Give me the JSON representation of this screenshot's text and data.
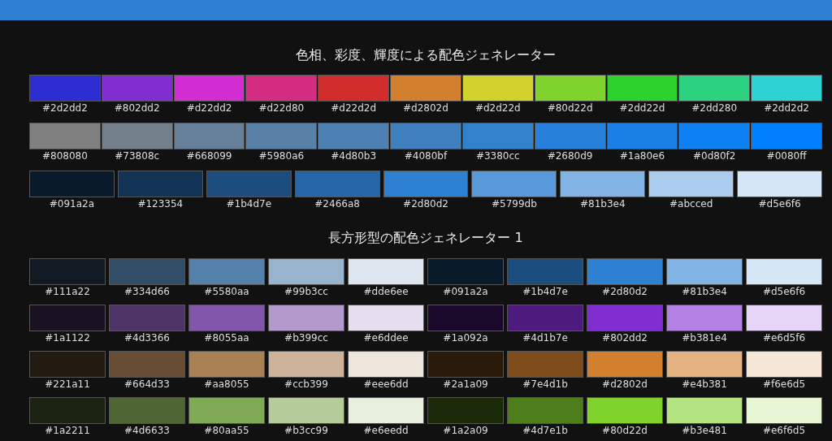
{
  "sections": [
    {
      "title": "色相、彩度、輝度による配色ジェネレーター",
      "grids": [
        [
          [
            {
              "label": "#2d2dd2",
              "color": "#2d2dd2"
            },
            {
              "label": "#802dd2",
              "color": "#802dd2"
            },
            {
              "label": "#d22dd2",
              "color": "#d22dd2"
            },
            {
              "label": "#d22d80",
              "color": "#d22d80"
            },
            {
              "label": "#d22d2d",
              "color": "#d22d2d"
            },
            {
              "label": "#d2802d",
              "color": "#d2802d"
            },
            {
              "label": "#d2d22d",
              "color": "#d2d22d"
            },
            {
              "label": "#80d22d",
              "color": "#80d22d"
            },
            {
              "label": "#2dd22d",
              "color": "#2dd22d"
            },
            {
              "label": "#2dd280",
              "color": "#2dd280"
            },
            {
              "label": "#2dd2d2",
              "color": "#2dd2d2"
            }
          ],
          [
            {
              "label": "#808080",
              "color": "#808080"
            },
            {
              "label": "#73808c",
              "color": "#73808c"
            },
            {
              "label": "#668099",
              "color": "#668099"
            },
            {
              "label": "#5980a6",
              "color": "#5980a6"
            },
            {
              "label": "#4d80b3",
              "color": "#4d80b3"
            },
            {
              "label": "#4080bf",
              "color": "#4080bf"
            },
            {
              "label": "#3380cc",
              "color": "#3380cc"
            },
            {
              "label": "#2680d9",
              "color": "#2680d9"
            },
            {
              "label": "#1a80e6",
              "color": "#1a80e6"
            },
            {
              "label": "#0d80f2",
              "color": "#0d80f2"
            },
            {
              "label": "#0080ff",
              "color": "#0080ff"
            }
          ]
        ],
        [
          [
            {
              "label": "#091a2a",
              "color": "#091a2a"
            },
            {
              "label": "#123354",
              "color": "#123354"
            },
            {
              "label": "#1b4d7e",
              "color": "#1b4d7e"
            },
            {
              "label": "#2466a8",
              "color": "#2466a8"
            },
            {
              "label": "#2d80d2",
              "color": "#2d80d2"
            },
            {
              "label": "#5799db",
              "color": "#5799db"
            },
            {
              "label": "#81b3e4",
              "color": "#81b3e4"
            },
            {
              "label": "#abcced",
              "color": "#abcced"
            },
            {
              "label": "#d5e6f6",
              "color": "#d5e6f6"
            }
          ]
        ]
      ]
    },
    {
      "title": "長方形型の配色ジェネレーター 1",
      "grids": [
        [
          [
            {
              "label": "#111a22",
              "color": "#111a22"
            },
            {
              "label": "#334d66",
              "color": "#334d66"
            },
            {
              "label": "#5580aa",
              "color": "#5580aa"
            },
            {
              "label": "#99b3cc",
              "color": "#99b3cc"
            },
            {
              "label": "#dde6ee",
              "color": "#dde6ee"
            },
            {
              "label": "#091a2a",
              "color": "#091a2a"
            },
            {
              "label": "#1b4d7e",
              "color": "#1b4d7e"
            },
            {
              "label": "#2d80d2",
              "color": "#2d80d2"
            },
            {
              "label": "#81b3e4",
              "color": "#81b3e4"
            },
            {
              "label": "#d5e6f6",
              "color": "#d5e6f6"
            }
          ],
          [
            {
              "label": "#1a1122",
              "color": "#1a1122"
            },
            {
              "label": "#4d3366",
              "color": "#4d3366"
            },
            {
              "label": "#8055aa",
              "color": "#8055aa"
            },
            {
              "label": "#b399cc",
              "color": "#b399cc"
            },
            {
              "label": "#e6ddee",
              "color": "#e6ddee"
            },
            {
              "label": "#1a092a",
              "color": "#1a092a"
            },
            {
              "label": "#4d1b7e",
              "color": "#4d1b7e"
            },
            {
              "label": "#802dd2",
              "color": "#802dd2"
            },
            {
              "label": "#b381e4",
              "color": "#b381e4"
            },
            {
              "label": "#e6d5f6",
              "color": "#e6d5f6"
            }
          ],
          [
            {
              "label": "#221a11",
              "color": "#221a11"
            },
            {
              "label": "#664d33",
              "color": "#664d33"
            },
            {
              "label": "#aa8055",
              "color": "#aa8055"
            },
            {
              "label": "#ccb399",
              "color": "#ccb399"
            },
            {
              "label": "#eee6dd",
              "color": "#eee6dd"
            },
            {
              "label": "#2a1a09",
              "color": "#2a1a09"
            },
            {
              "label": "#7e4d1b",
              "color": "#7e4d1b"
            },
            {
              "label": "#d2802d",
              "color": "#d2802d"
            },
            {
              "label": "#e4b381",
              "color": "#e4b381"
            },
            {
              "label": "#f6e6d5",
              "color": "#f6e6d5"
            }
          ],
          [
            {
              "label": "#1a2211",
              "color": "#1a2211"
            },
            {
              "label": "#4d6633",
              "color": "#4d6633"
            },
            {
              "label": "#80aa55",
              "color": "#80aa55"
            },
            {
              "label": "#b3cc99",
              "color": "#b3cc99"
            },
            {
              "label": "#e6eedd",
              "color": "#e6eedd"
            },
            {
              "label": "#1a2a09",
              "color": "#1a2a09"
            },
            {
              "label": "#4d7e1b",
              "color": "#4d7e1b"
            },
            {
              "label": "#80d22d",
              "color": "#80d22d"
            },
            {
              "label": "#b3e481",
              "color": "#b3e481"
            },
            {
              "label": "#e6f6d5",
              "color": "#e6f6d5"
            }
          ]
        ]
      ]
    }
  ]
}
